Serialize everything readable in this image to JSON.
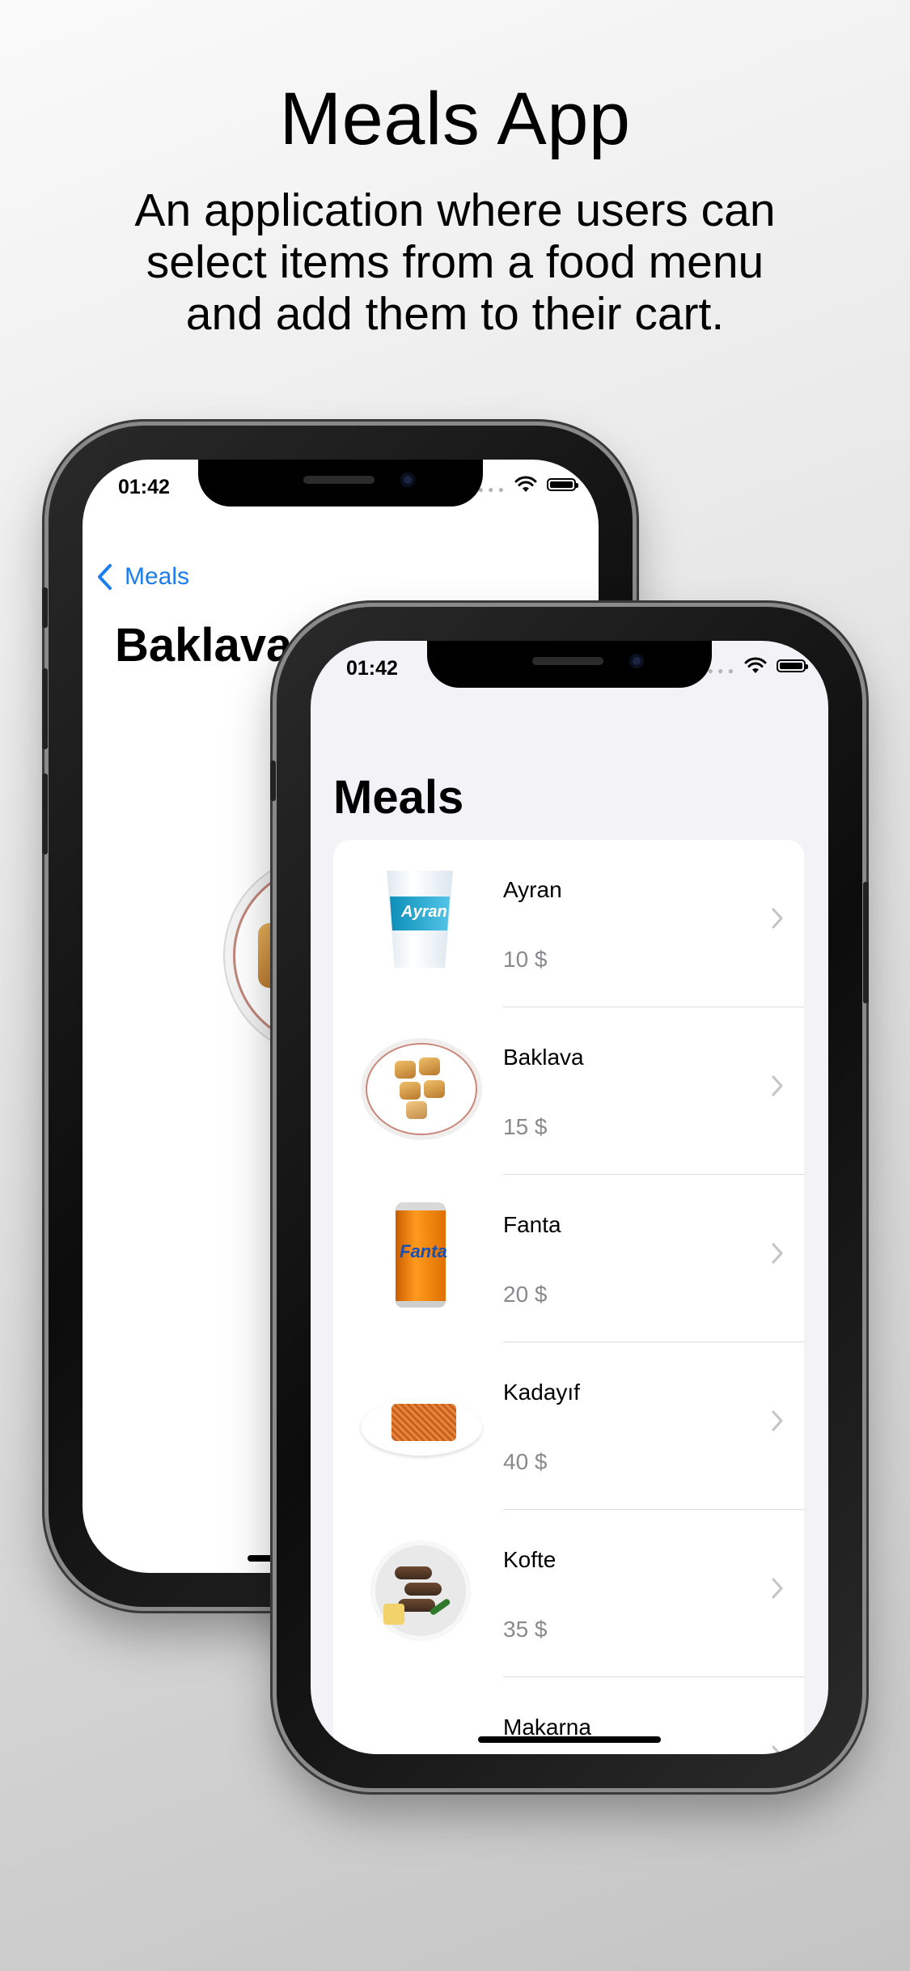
{
  "header": {
    "title": "Meals App",
    "subtitle_lines": [
      "An application where users can",
      "select items from a food menu",
      "and add them to their cart."
    ]
  },
  "detail_screen": {
    "time": "01:42",
    "back_label": "Meals",
    "title": "Baklava"
  },
  "list_screen": {
    "time": "01:42",
    "title": "Meals",
    "items": [
      {
        "name": "Ayran",
        "price": "10 $",
        "image": "ayran-cup"
      },
      {
        "name": "Baklava",
        "price": "15 $",
        "image": "baklava-plate"
      },
      {
        "name": "Fanta",
        "price": "20 $",
        "image": "fanta-can"
      },
      {
        "name": "Kadayıf",
        "price": "40 $",
        "image": "kadayif-plate"
      },
      {
        "name": "Kofte",
        "price": "35 $",
        "image": "kofte-plate"
      },
      {
        "name": "Makarna",
        "price": "",
        "image": "makarna-plate"
      }
    ],
    "ayran_logo_text": "Ayran",
    "fanta_logo_text": "Fanta"
  },
  "colors": {
    "accent": "#1a7df2",
    "list_background": "#f2f2f7",
    "secondary_text": "#8a8a8e"
  }
}
